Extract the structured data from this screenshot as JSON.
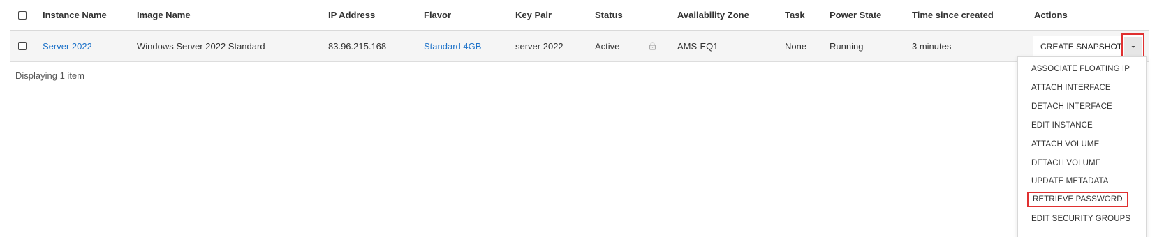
{
  "table": {
    "columns": [
      "Instance Name",
      "Image Name",
      "IP Address",
      "Flavor",
      "Key Pair",
      "Status",
      "Availability Zone",
      "Task",
      "Power State",
      "Time since created",
      "Actions"
    ],
    "row": {
      "instance_name": "Server 2022",
      "image_name": "Windows Server 2022 Standard",
      "ip_address": "83.96.215.168",
      "flavor": "Standard 4GB",
      "key_pair": "server 2022",
      "status": "Active",
      "availability_zone": "AMS-EQ1",
      "task": "None",
      "power_state": "Running",
      "time_since_created": "3 minutes"
    },
    "footer": "Displaying 1 item"
  },
  "actions": {
    "primary_label": "CREATE SNAPSHOT",
    "menu_items": [
      "ASSOCIATE FLOATING IP",
      "ATTACH INTERFACE",
      "DETACH INTERFACE",
      "EDIT INSTANCE",
      "ATTACH VOLUME",
      "DETACH VOLUME",
      "UPDATE METADATA",
      "RETRIEVE PASSWORD",
      "EDIT SECURITY GROUPS"
    ],
    "highlighted_item": "RETRIEVE PASSWORD"
  },
  "icons": {
    "lock": "lock-icon",
    "caret": "caret-down-icon"
  },
  "colors": {
    "link": "#1f73c9",
    "highlight_border": "#e03030",
    "row_background": "#f5f5f5"
  }
}
